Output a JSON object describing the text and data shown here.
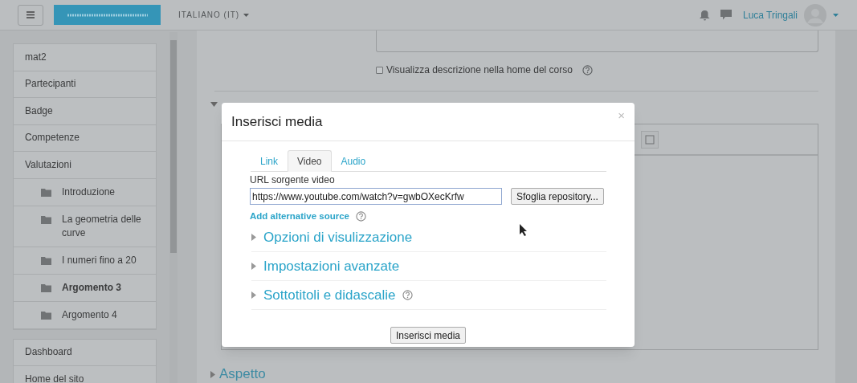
{
  "header": {
    "language": "ITALIANO (IT)",
    "user_name": "Luca Tringali"
  },
  "sidebar": {
    "course_items": [
      {
        "label": "mat2",
        "kind": "link",
        "selected": false
      },
      {
        "label": "Partecipanti",
        "kind": "link",
        "selected": false
      },
      {
        "label": "Badge",
        "kind": "link",
        "selected": false
      },
      {
        "label": "Competenze",
        "kind": "link",
        "selected": false
      },
      {
        "label": "Valutazioni",
        "kind": "link",
        "selected": false
      },
      {
        "label": "Introduzione",
        "kind": "section",
        "selected": false
      },
      {
        "label": "La geometria delle curve",
        "kind": "section",
        "selected": false
      },
      {
        "label": "I numeri fino a 20",
        "kind": "section",
        "selected": false
      },
      {
        "label": "Argomento 3",
        "kind": "section",
        "selected": true
      },
      {
        "label": "Argomento 4",
        "kind": "section",
        "selected": false
      }
    ],
    "site_items": [
      {
        "label": "Dashboard",
        "selected": false
      },
      {
        "label": "Home del sito",
        "selected": false
      }
    ]
  },
  "form": {
    "description_checkbox": {
      "label": "Visualizza descrizione nella home del corso",
      "checked": false
    },
    "sections": [
      {
        "title": "Aspetto",
        "expanded": false
      }
    ]
  },
  "dialog": {
    "title": "Inserisci media",
    "close": "×",
    "tabs": [
      {
        "label": "Link",
        "selected": false
      },
      {
        "label": "Video",
        "selected": true
      },
      {
        "label": "Audio",
        "selected": false
      }
    ],
    "url_label": "URL sorgente video",
    "url_value": "https://www.youtube.com/watch?v=gwbOXecKrfw",
    "browse_button": "Sfoglia repository...",
    "add_source_link": "Add alternative source",
    "sections": [
      {
        "title": "Opzioni di visulizzazione",
        "expanded": false,
        "help": false
      },
      {
        "title": "Impostazioni avanzate",
        "expanded": false,
        "help": false
      },
      {
        "title": "Sottotitoli e didascalie",
        "expanded": false,
        "help": true
      }
    ],
    "submit_button": "Inserisci media"
  }
}
